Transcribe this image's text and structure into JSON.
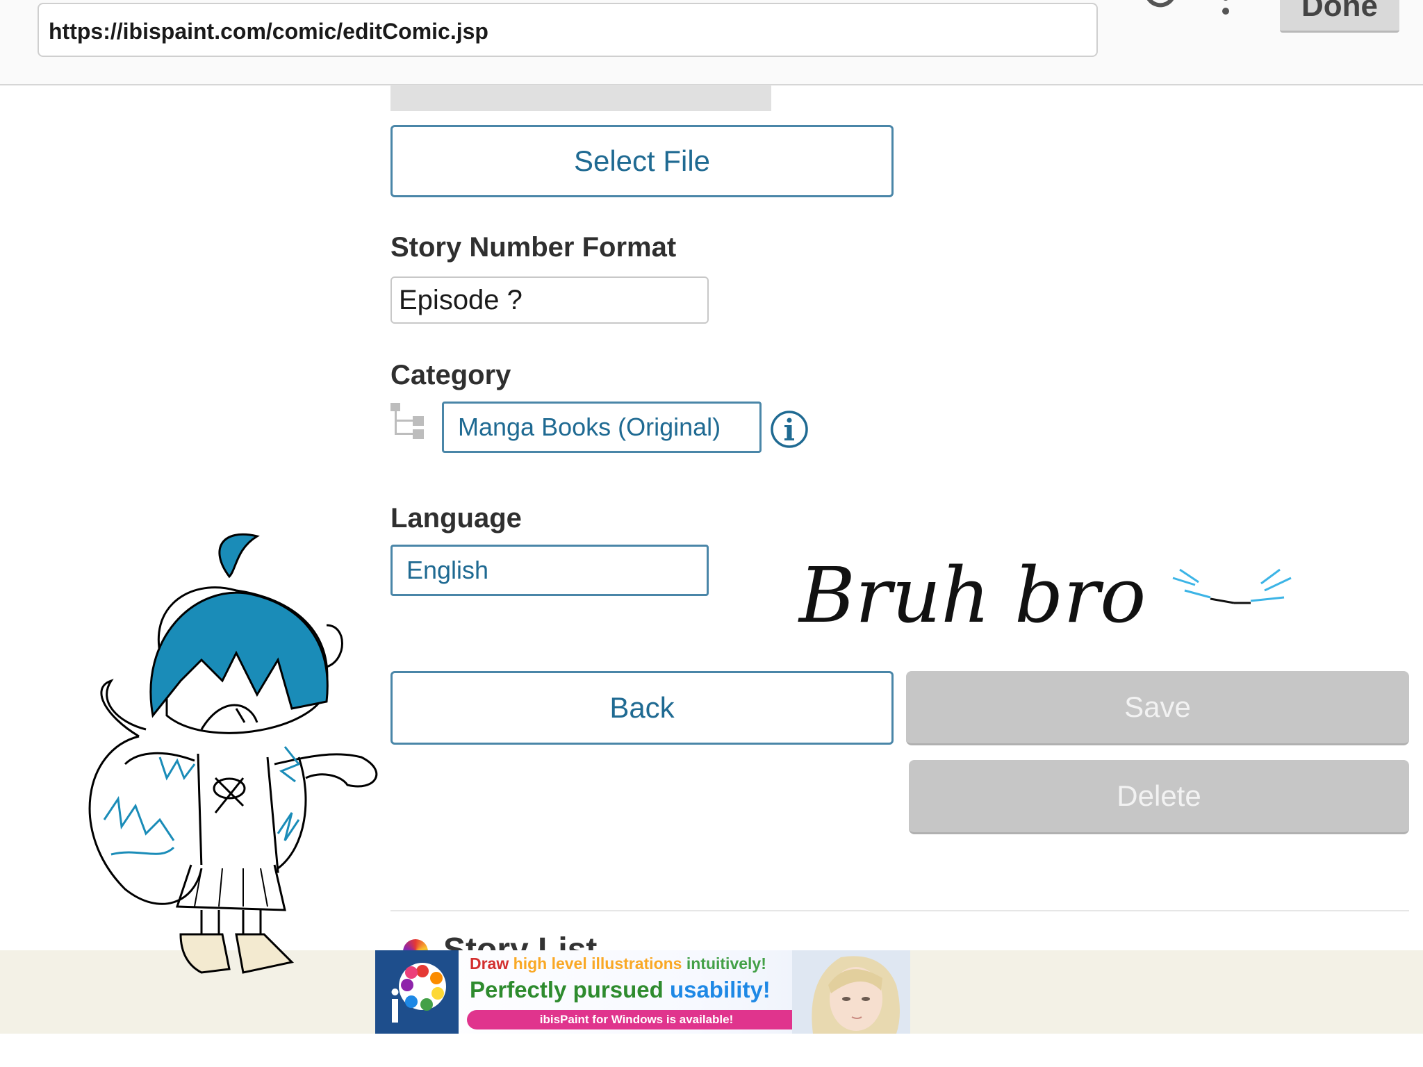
{
  "browser": {
    "url": "https://ibispaint.com/comic/editComic.jsp",
    "done_label": "Done"
  },
  "form": {
    "select_file_label": "Select File",
    "story_number_format_label": "Story Number Format",
    "story_number_format_value": "Episode ?",
    "category_label": "Category",
    "category_value": "Manga Books (Original)",
    "language_label": "Language",
    "language_value": "English",
    "back_label": "Back",
    "save_label": "Save",
    "delete_label": "Delete",
    "story_list_label": "Story List"
  },
  "ad": {
    "line1_words": [
      "Draw",
      "high level illustrations",
      "intuitively!"
    ],
    "line2_words": [
      "Perfectly pursued",
      "usability!"
    ],
    "pill_text": "ibisPaint for Windows is available!",
    "logo_text": "iP"
  },
  "doodle": {
    "handwritten_text": "Bruh bro"
  },
  "colors": {
    "accent_blue": "#1f6a92",
    "border_blue": "#4a86a8",
    "disabled_gray": "#c6c6c6",
    "doodle_blue": "#1a8cb8"
  }
}
